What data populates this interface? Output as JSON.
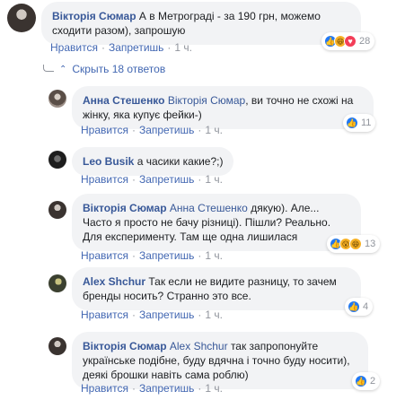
{
  "comments": [
    {
      "author": "Вікторія Сюмар",
      "text": "А в Метроградi - за 190 грн, можемо сходити разом), запрошую",
      "like": "Нравится",
      "reply": "Запретишь",
      "time": "1 ч.",
      "reactions": [
        "like-icon",
        "haha-icon",
        "love-icon"
      ],
      "count": "28"
    },
    {
      "author": "Анна Стешенко",
      "mention": "Вікторія Сюмар",
      "text": ", ви точно не схожі на жінку, яка купує фейки-)",
      "like": "Нравится",
      "reply": "Запретишь",
      "time": "1 ч.",
      "reactions": [
        "like-icon"
      ],
      "count": "11"
    },
    {
      "author": "Leo Busik",
      "text": "а часики какие?;)",
      "like": "Нравится",
      "reply": "Запретишь",
      "time": "1 ч."
    },
    {
      "author": "Вікторія Сюмар",
      "mention": "Анна Стешенко",
      "text": "дякую). Але... Часто я просто не бачу різниці). Пішли? Реально. Для експерименту. Там ще одна лишилася",
      "like": "Нравится",
      "reply": "Запретишь",
      "time": "1 ч.",
      "reactions": [
        "like-icon",
        "haha-icon",
        "haha-icon"
      ],
      "count": "13"
    },
    {
      "author": "Alex Shchur",
      "text": "Так если не видите разницу, то зачем бренды носить? Странно это все.",
      "like": "Нравится",
      "reply": "Запретишь",
      "time": "1 ч.",
      "reactions": [
        "like-icon"
      ],
      "count": "4"
    },
    {
      "author": "Вікторія Сюмар",
      "mention": "Alex Shchur",
      "text": "так запропонуйте українське подібне, буду вдячна і точно буду носити), деякі брошки навіть сама роблю)",
      "like": "Нравится",
      "reply": "Запретишь",
      "time": "1 ч.",
      "reactions": [
        "like-icon"
      ],
      "count": "2"
    }
  ],
  "hide_replies": "Скрыть 18 ответов",
  "colors": {
    "link": "#385898",
    "action": "#4267b2",
    "meta": "#90949c",
    "bubble": "#f2f3f5"
  }
}
